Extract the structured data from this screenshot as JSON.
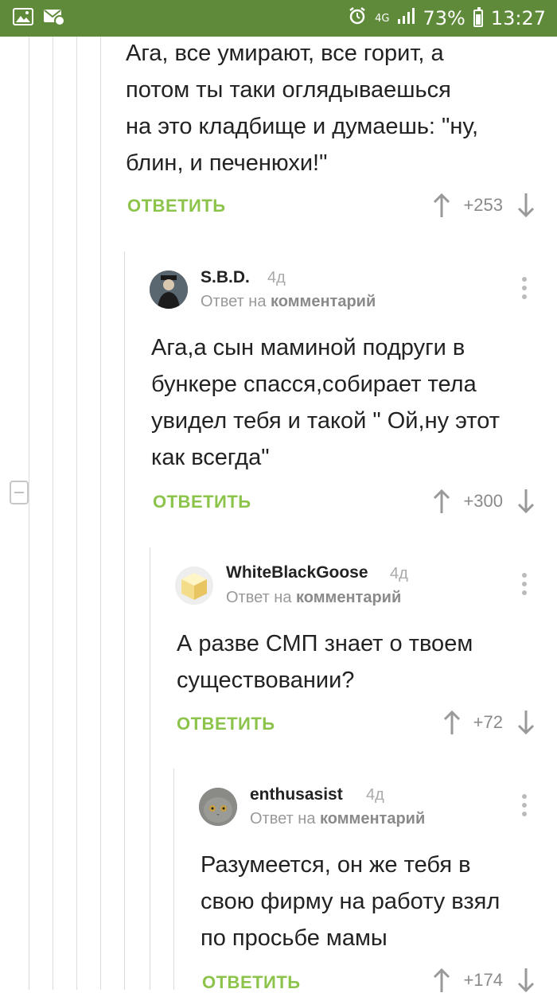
{
  "status_bar": {
    "network": "4G",
    "battery": "73%",
    "time": "13:27"
  },
  "comments": [
    {
      "text_lines": [
        "Ага, все умирают, все горит, а",
        "потом ты таки оглядываешься",
        "на это кладбище и думаешь: \"ну,",
        "блин, и печенюхи!\""
      ],
      "reply_label": "ОТВЕТИТЬ",
      "score": "+253"
    },
    {
      "author": "S.B.D.",
      "time": "4д",
      "reply_prefix": "Ответ на",
      "reply_target": "комментарий",
      "text_lines": [
        "Ага,а сын маминой подруги в",
        "бункере спасся,собирает тела",
        "увидел тебя и такой \" Ой,ну этот",
        "как всегда\""
      ],
      "reply_label": "ОТВЕТИТЬ",
      "score": "+300"
    },
    {
      "author": "WhiteBlackGoose",
      "time": "4д",
      "reply_prefix": "Ответ на",
      "reply_target": "комментарий",
      "text_lines": [
        "А разве СМП знает о твоем",
        "существовании?"
      ],
      "reply_label": "ОТВЕТИТЬ",
      "score": "+72"
    },
    {
      "author": "enthusasist",
      "time": "4д",
      "reply_prefix": "Ответ на",
      "reply_target": "комментарий",
      "text_lines": [
        "Разумеется, он же тебя в",
        "свою фирму на работу взял",
        "по просьбе мамы"
      ],
      "reply_label": "ОТВЕТИТЬ",
      "score": "+174"
    }
  ],
  "colors": {
    "status_bar": "#5e8a3a",
    "reply_green": "#8cc34a",
    "text": "#222222",
    "muted": "#999999"
  },
  "icons": [
    "image-icon",
    "mail-icon",
    "alarm-icon",
    "signal-icon",
    "battery-icon",
    "vote-up-icon",
    "vote-down-icon",
    "more-vert-icon",
    "collapse-thread-icon"
  ]
}
